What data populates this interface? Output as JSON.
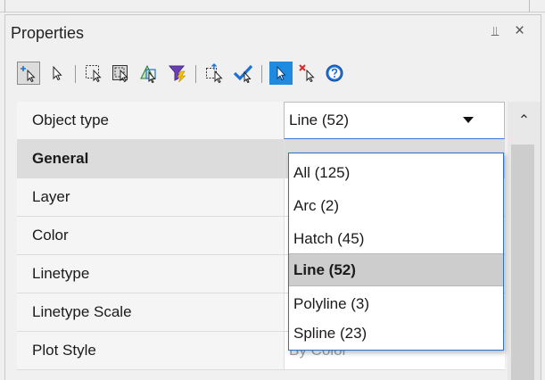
{
  "palette": {
    "title": "Properties",
    "pin_glyph": "⫫",
    "close_glyph": "×"
  },
  "toolbar": {
    "buttons": [
      {
        "name": "add-to-selection-icon",
        "pressed": true
      },
      {
        "name": "select-objects-icon",
        "pressed": false
      },
      {
        "name": "window-select-icon",
        "pressed": false
      },
      {
        "name": "crossing-select-icon",
        "pressed": false
      },
      {
        "name": "select-similar-icon",
        "pressed": false
      },
      {
        "name": "quick-select-filter-icon",
        "pressed": false
      },
      {
        "name": "select-group-icon",
        "pressed": false
      },
      {
        "name": "select-all-check-icon",
        "pressed": false
      },
      {
        "name": "pickadd-toggle-icon",
        "pressed": false
      },
      {
        "name": "deselect-icon",
        "pressed": false
      },
      {
        "name": "help-icon",
        "pressed": false
      }
    ]
  },
  "grid": {
    "object_type": {
      "label": "Object type",
      "value": "Line (52)"
    },
    "category": {
      "label": "General"
    },
    "rows": [
      {
        "label": "Layer",
        "value": ""
      },
      {
        "label": "Color",
        "value": ""
      },
      {
        "label": "Linetype",
        "value": ""
      },
      {
        "label": "Linetype Scale",
        "value": ""
      },
      {
        "label": "Plot Style",
        "value": "By Color"
      }
    ],
    "scroll_up_glyph": "⌃"
  },
  "dropdown": {
    "options": [
      "All (125)",
      "Arc (2)",
      "Hatch (45)",
      "Line (52)",
      "Polyline (3)",
      "Spline (23)"
    ],
    "selected": "Line (52)"
  },
  "colors": {
    "accent": "#2a72cc",
    "selected_option": "#cdcdcd",
    "category_row": "#dcdcdc"
  }
}
